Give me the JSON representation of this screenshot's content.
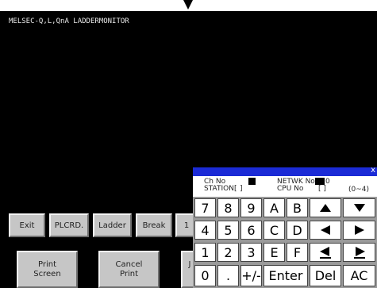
{
  "title": "MELSEC-Q,L,QnA LADDERMONITOR",
  "function_keys_row1": [
    "Exit",
    "PLCRD.",
    "Ladder",
    "Break",
    "1"
  ],
  "function_keys_row2": [
    {
      "line1": "Print",
      "line2": "Screen"
    },
    {
      "line1": "Cancel",
      "line2": "Print"
    },
    {
      "line1": "J",
      "line2": ""
    }
  ],
  "keypad": {
    "close_label": "x",
    "ch_no_label": "Ch No",
    "station_label": "STATION[",
    "station_close": "]",
    "netwk_label": "NETWK No[",
    "netwk_value": "0",
    "cpu_label": "CPU No",
    "cpu_bracket": "[  ]",
    "range": "(0~4)",
    "rows": [
      [
        "7",
        "8",
        "9",
        "A",
        "B",
        "up-arrow-icon",
        "down-arrow-icon"
      ],
      [
        "4",
        "5",
        "6",
        "C",
        "D",
        "left-arrow-icon",
        "right-arrow-icon"
      ],
      [
        "1",
        "2",
        "3",
        "E",
        "F",
        "home-icon",
        "end-icon"
      ],
      [
        "0",
        ".",
        "+/-",
        "Enter",
        "Del",
        "AC"
      ]
    ]
  }
}
